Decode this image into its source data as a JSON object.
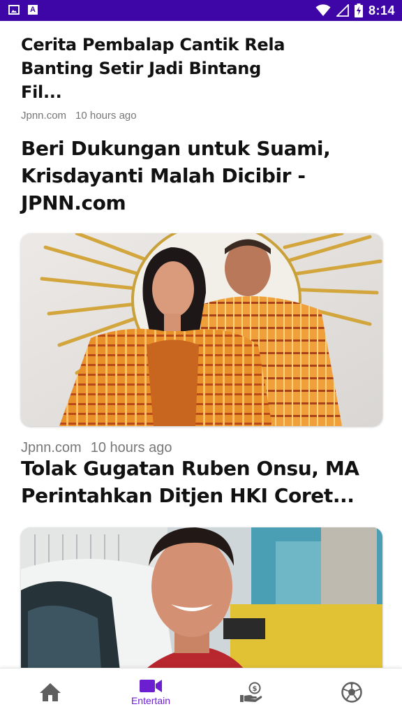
{
  "status_bar": {
    "time": "8:14",
    "left_icons": [
      "image-notification-icon",
      "a-notification-icon"
    ],
    "right_icons": [
      "wifi-icon",
      "signal-icon",
      "battery-charging-icon"
    ]
  },
  "articles": [
    {
      "title": "Cerita Pembalap Cantik Rela Banting Setir Jadi Bintang Fil...",
      "source": "Jpnn.com",
      "time": "10 hours ago"
    },
    {
      "title": "Beri Dukungan untuk Suami, Krisdayanti Malah Dicibir - JPNN.com",
      "source": "Jpnn.com",
      "time": "10 hours ago",
      "image": "couple-in-orange-traditional-outfits-photo"
    },
    {
      "title": "Tolak Gugatan Ruben Onsu, MA Perintahkan Ditjen HKI Coret...",
      "image": "smiling-man-in-red-shirt-photo"
    }
  ],
  "bottom_nav": {
    "active_index": 1,
    "active_color": "#6b1fd0",
    "items": [
      {
        "icon": "home-icon",
        "label": ""
      },
      {
        "icon": "video-camera-icon",
        "label": "Entertain"
      },
      {
        "icon": "money-hand-icon",
        "label": ""
      },
      {
        "icon": "soccer-ball-icon",
        "label": ""
      }
    ]
  },
  "colors": {
    "status_bar_bg": "#3f06a7",
    "accent": "#6b1fd0",
    "title_text": "#111111",
    "meta_text": "#777777"
  }
}
